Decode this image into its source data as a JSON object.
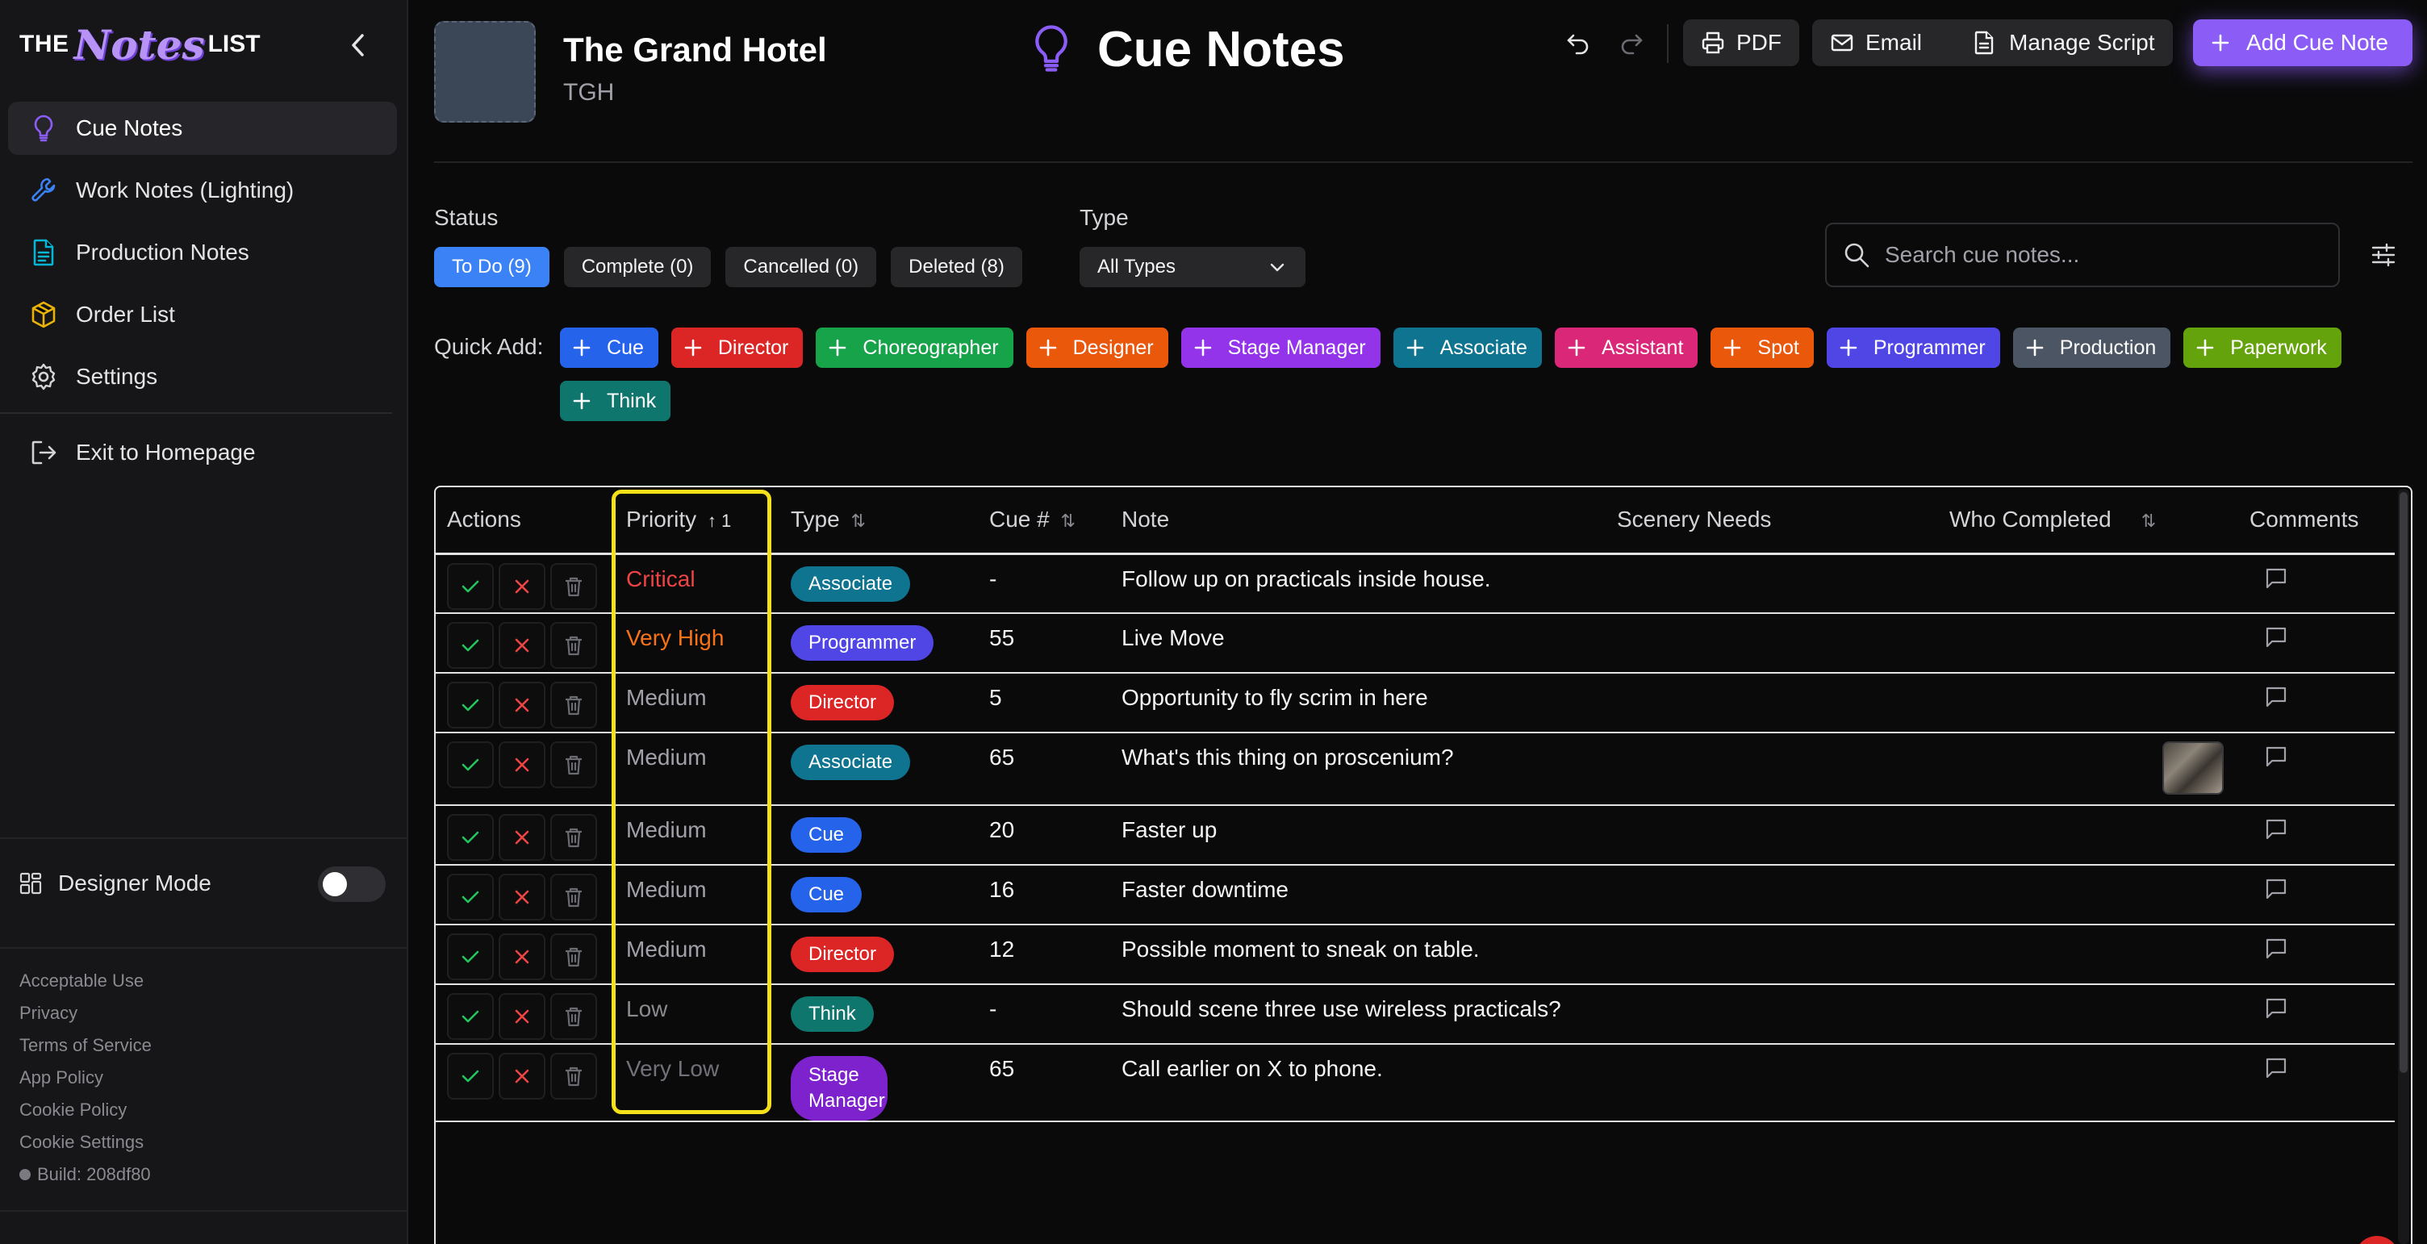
{
  "brand": {
    "the": "THE",
    "notes": "Notes",
    "list": "LIST"
  },
  "sidebar": {
    "items": [
      {
        "label": "Cue Notes",
        "icon": "lightbulb-icon",
        "active": true
      },
      {
        "label": "Work Notes (Lighting)",
        "icon": "wrench-icon"
      },
      {
        "label": "Production Notes",
        "icon": "document-icon"
      },
      {
        "label": "Order List",
        "icon": "package-icon"
      },
      {
        "label": "Settings",
        "icon": "gear-icon"
      }
    ],
    "exit_label": "Exit to Homepage",
    "designer_mode_label": "Designer Mode",
    "designer_mode_on": false,
    "footer_links": [
      "Acceptable Use",
      "Privacy",
      "Terms of Service",
      "App Policy",
      "Cookie Policy",
      "Cookie Settings"
    ],
    "build": "Build: 208df80"
  },
  "production": {
    "title": "The Grand Hotel",
    "abbr": "TGH"
  },
  "page": {
    "title": "Cue Notes",
    "accent": "#8b5cf6"
  },
  "toolbar": {
    "pdf": "PDF",
    "email": "Email",
    "manage_script": "Manage Script",
    "add_cue_note": "Add Cue Note"
  },
  "filters": {
    "status_label": "Status",
    "status_chips": [
      "To Do (9)",
      "Complete (0)",
      "Cancelled (0)",
      "Deleted (8)"
    ],
    "active_status": 0,
    "type_label": "Type",
    "type_value": "All Types",
    "search_placeholder": "Search cue notes..."
  },
  "quick_add": {
    "label": "Quick Add:",
    "buttons": [
      {
        "label": "Cue",
        "color": "#2563eb"
      },
      {
        "label": "Director",
        "color": "#dc2626"
      },
      {
        "label": "Choreographer",
        "color": "#16a34a"
      },
      {
        "label": "Designer",
        "color": "#ea580c"
      },
      {
        "label": "Stage Manager",
        "color": "#9333ea"
      },
      {
        "label": "Associate",
        "color": "#0e7490"
      },
      {
        "label": "Assistant",
        "color": "#db2777"
      },
      {
        "label": "Spot",
        "color": "#ea580c"
      },
      {
        "label": "Programmer",
        "color": "#4f46e5"
      },
      {
        "label": "Production",
        "color": "#4b5563"
      },
      {
        "label": "Paperwork",
        "color": "#65a30d"
      },
      {
        "label": "Think",
        "color": "#0f766e"
      }
    ]
  },
  "table": {
    "columns": {
      "actions": "Actions",
      "priority": "Priority",
      "priority_sort": "↑ 1",
      "type": "Type",
      "cue": "Cue #",
      "note": "Note",
      "scenery": "Scenery Needs",
      "who_completed": "Who Completed",
      "comments": "Comments"
    },
    "rows": [
      {
        "priority": "Critical",
        "priority_color": "#ef4444",
        "type": "Associate",
        "type_color": "#0e7490",
        "cue": "-",
        "note": "Follow up on practicals inside house.",
        "has_image": false
      },
      {
        "priority": "Very High",
        "priority_color": "#f97316",
        "type": "Programmer",
        "type_color": "#4f46e5",
        "cue": "55",
        "note": "Live Move",
        "has_image": false
      },
      {
        "priority": "Medium",
        "priority_color": "#a1a1aa",
        "type": "Director",
        "type_color": "#dc2626",
        "cue": "5",
        "note": "Opportunity to fly scrim in here",
        "has_image": false
      },
      {
        "priority": "Medium",
        "priority_color": "#a1a1aa",
        "type": "Associate",
        "type_color": "#0e7490",
        "cue": "65",
        "note": "What's this thing on proscenium?",
        "has_image": true
      },
      {
        "priority": "Medium",
        "priority_color": "#a1a1aa",
        "type": "Cue",
        "type_color": "#2563eb",
        "cue": "20",
        "note": "Faster up",
        "has_image": false
      },
      {
        "priority": "Medium",
        "priority_color": "#a1a1aa",
        "type": "Cue",
        "type_color": "#2563eb",
        "cue": "16",
        "note": "Faster downtime",
        "has_image": false
      },
      {
        "priority": "Medium",
        "priority_color": "#a1a1aa",
        "type": "Director",
        "type_color": "#dc2626",
        "cue": "12",
        "note": "Possible moment to sneak on table.",
        "has_image": false
      },
      {
        "priority": "Low",
        "priority_color": "#8a8a90",
        "type": "Think",
        "type_color": "#0f766e",
        "cue": "-",
        "note": "Should scene three use wireless practicals?",
        "has_image": false
      },
      {
        "priority": "Very Low",
        "priority_color": "#71717a",
        "type": "Stage Manager",
        "type_color": "#7e22ce",
        "cue": "65",
        "note": "Call earlier on X to phone.",
        "has_image": false
      }
    ]
  }
}
